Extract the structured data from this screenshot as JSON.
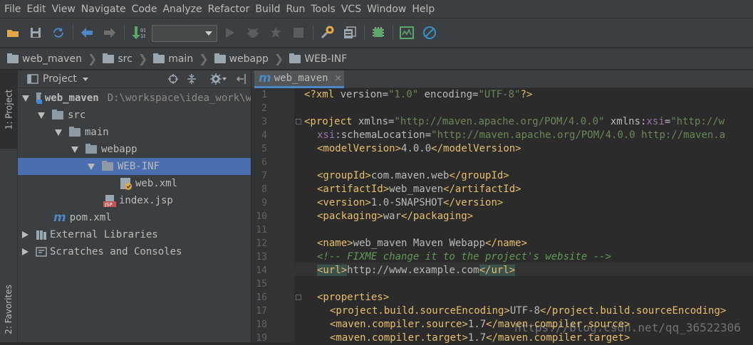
{
  "menubar": {
    "items": [
      "File",
      "Edit",
      "View",
      "Navigate",
      "Code",
      "Analyze",
      "Refactor",
      "Build",
      "Run",
      "Tools",
      "VCS",
      "Window",
      "Help"
    ]
  },
  "toolbar": {
    "buttons": [
      "open-icon",
      "save-icon",
      "sync-icon",
      "back-icon",
      "forward-icon",
      "build-icon",
      "run-icon",
      "debug-icon",
      "coverage-icon",
      "stop-icon",
      "settings-icon",
      "project-structure-icon",
      "sdk-icon",
      "monitor-icon",
      "block-icon"
    ],
    "config_select_value": ""
  },
  "breadcrumb": [
    "web_maven",
    "src",
    "main",
    "webapp",
    "WEB-INF"
  ],
  "left_stripe": {
    "project_tab": "1: Project",
    "favorites_tab": "2: Favorites"
  },
  "project_panel": {
    "title": "Project",
    "tree": [
      {
        "label": "web_maven",
        "path": "D:\\workspace\\idea_work\\w",
        "depth": 0,
        "expanded": true,
        "icon": "module-folder-icon"
      },
      {
        "label": "src",
        "depth": 1,
        "expanded": true,
        "icon": "folder-icon"
      },
      {
        "label": "main",
        "depth": 2,
        "expanded": true,
        "icon": "folder-icon"
      },
      {
        "label": "webapp",
        "depth": 3,
        "expanded": true,
        "icon": "folder-icon"
      },
      {
        "label": "WEB-INF",
        "depth": 4,
        "expanded": true,
        "icon": "folder-icon",
        "selected": true
      },
      {
        "label": "web.xml",
        "depth": 5,
        "icon": "xml-file-icon"
      },
      {
        "label": "index.jsp",
        "depth": 4,
        "icon": "jsp-file-icon"
      },
      {
        "label": "pom.xml",
        "depth": 1,
        "icon": "maven-icon"
      },
      {
        "label": "External Libraries",
        "depth": 0,
        "expanded": false,
        "icon": "libraries-icon"
      },
      {
        "label": "Scratches and Consoles",
        "depth": 0,
        "expanded": false,
        "icon": "scratches-icon"
      }
    ]
  },
  "editor": {
    "tab_label": "web_maven",
    "line_numbers": [
      "1",
      "2",
      "3",
      "4",
      "5",
      "6",
      "7",
      "8",
      "9",
      "10",
      "11",
      "12",
      "13",
      "14",
      "15",
      "16",
      "17",
      "18",
      "19"
    ],
    "lines": {
      "l1": {
        "a": "<?xml ",
        "b": "version=",
        "c": "\"1.0\"",
        "d": " encoding=",
        "e": "\"UTF-8\"",
        "f": "?>"
      },
      "l3": {
        "a": "<project ",
        "b": "xmlns=",
        "c": "\"http://maven.apache.org/POM/4.0.0\"",
        "d": " xmlns:",
        "e": "xsi",
        "f": "=",
        "g": "\"http://w"
      },
      "l4": {
        "a": "xsi",
        "b": ":schemaLocation=",
        "c": "\"http://maven.apache.org/POM/4.0.0 http://maven.a"
      },
      "l5": {
        "a": "<modelVersion>",
        "b": "4.0.0",
        "c": "</modelVersion>"
      },
      "l7": {
        "a": "<groupId>",
        "b": "com.maven.web",
        "c": "</groupId>"
      },
      "l8": {
        "a": "<artifactId>",
        "b": "web_maven",
        "c": "</artifactId>"
      },
      "l9": {
        "a": "<version>",
        "b": "1.0-SNAPSHOT",
        "c": "</version>"
      },
      "l10": {
        "a": "<packaging>",
        "b": "war",
        "c": "</packaging>"
      },
      "l12": {
        "a": "<name>",
        "b": "web_maven Maven Webapp",
        "c": "</name>"
      },
      "l13": {
        "a": "<!-- FIXME change it to the project's website -->"
      },
      "l14": {
        "a": "<url>",
        "b": "http://www.example.com",
        "c": "</url>"
      },
      "l16": {
        "a": "<properties>"
      },
      "l17": {
        "a": "<project.build.sourceEncoding>",
        "b": "UTF-8",
        "c": "</project.build.sourceEncoding>"
      },
      "l18": {
        "a": "<maven.compiler.source>",
        "b": "1.7",
        "c": "</maven.compiler.source>"
      },
      "l19": {
        "a": "<maven.compiler.target>",
        "b": "1.7",
        "c": "</maven.compiler.target>"
      }
    }
  },
  "watermark": "https://blog.csdn.net/qq_36522306"
}
